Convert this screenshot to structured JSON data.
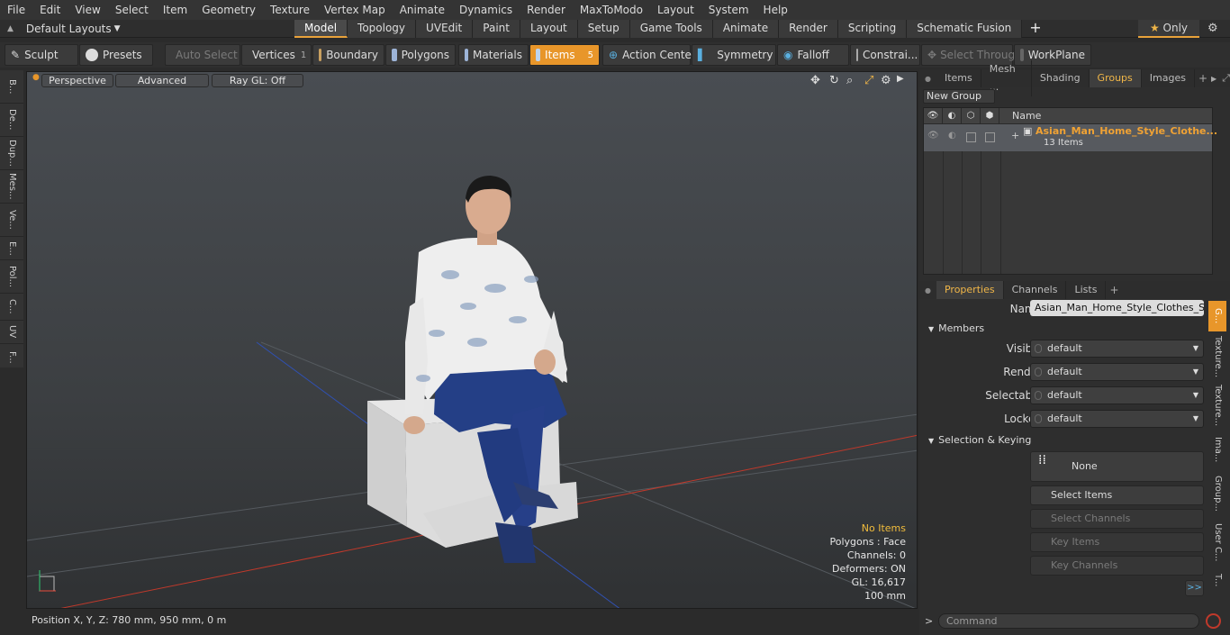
{
  "menu": [
    "File",
    "Edit",
    "View",
    "Select",
    "Item",
    "Geometry",
    "Texture",
    "Vertex Map",
    "Animate",
    "Dynamics",
    "Render",
    "MaxToModo",
    "Layout",
    "System",
    "Help"
  ],
  "layout_selector": "Default Layouts",
  "tabs": [
    "Model",
    "Topology",
    "UVEdit",
    "Paint",
    "Layout",
    "Setup",
    "Game Tools",
    "Animate",
    "Render",
    "Scripting",
    "Schematic Fusion"
  ],
  "only_label": "Only",
  "toolbar": {
    "sculpt": "Sculpt",
    "presets": "Presets",
    "auto_select": "Auto Select",
    "vertices": "Vertices",
    "vertices_count": "1",
    "boundary": "Boundary",
    "polygons": "Polygons",
    "materials": "Materials",
    "items": "Items",
    "items_count": "5",
    "action_center": "Action Center",
    "symmetry": "Symmetry",
    "falloff": "Falloff",
    "constraints": "Constrai...",
    "select_through": "Select Through",
    "workplane": "WorkPlane"
  },
  "left_tools": [
    "B...",
    "De...",
    "Dup...",
    "Mes...",
    "Ve...",
    "E...",
    "Pol...",
    "C...",
    "UV",
    "F..."
  ],
  "viewport": {
    "perspective": "Perspective",
    "advanced": "Advanced",
    "raygl": "Ray GL: Off",
    "hud": {
      "items": "No Items",
      "polygons": "Polygons : Face",
      "channels": "Channels: 0",
      "deformers": "Deformers: ON",
      "gl": "GL: 16,617",
      "unit": "100 mm"
    }
  },
  "status": "Position X, Y, Z:   780 mm, 950 mm, 0 m",
  "top_panel": {
    "tabs": [
      "Items",
      "Mesh ...",
      "Shading",
      "Groups",
      "Images"
    ],
    "new_group": "New Group",
    "col_name": "Name",
    "group_name": "Asian_Man_Home_Style_Clothe...",
    "group_count": "13 Items"
  },
  "props": {
    "tabs": [
      "Properties",
      "Channels",
      "Lists"
    ],
    "name_label": "Name",
    "name_value": "Asian_Man_Home_Style_Clothes_Sitti",
    "members": "Members",
    "visible_label": "Visible",
    "visible": "default",
    "render_label": "Render",
    "render": "default",
    "selectable_label": "Selectable",
    "selectable": "default",
    "locked_label": "Locked",
    "locked": "default",
    "sel_key": "Selection & Keying",
    "none": "None",
    "select_items": "Select Items",
    "select_channels": "Select Channels",
    "key_items": "Key Items",
    "key_channels": "Key Channels",
    "more": ">>"
  },
  "side_tabs": [
    "G...",
    "Texture...",
    "Texture...",
    "Ima...",
    "Group...",
    "User C...",
    "T..."
  ],
  "command_placeholder": "Command"
}
